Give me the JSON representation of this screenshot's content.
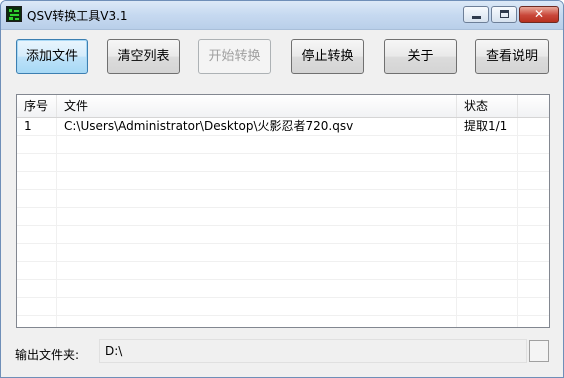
{
  "window": {
    "title": "QSV转换工具V3.1"
  },
  "toolbar": {
    "add_file": "添加文件",
    "clear_list": "清空列表",
    "start_convert": "开始转换",
    "stop_convert": "停止转换",
    "about": "关于",
    "view_help": "查看说明"
  },
  "table": {
    "columns": [
      "序号",
      "文件",
      "状态",
      ""
    ],
    "rows": [
      {
        "index": "1",
        "file": "C:\\Users\\Administrator\\Desktop\\火影忍者720.qsv",
        "status": "提取1/1"
      }
    ]
  },
  "output": {
    "label": "输出文件夹:",
    "path": "D:\\"
  },
  "icons": {
    "app": "app-icon",
    "minimize": "minimize-icon",
    "maximize": "maximize-icon",
    "close": "close-icon",
    "close_glyph": "✕"
  }
}
